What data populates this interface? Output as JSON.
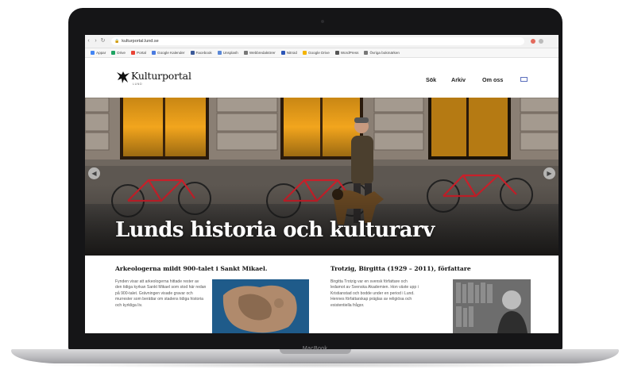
{
  "device": {
    "brand_label": "MacBook"
  },
  "browser": {
    "url": "kulturportal.lund.se",
    "bookmarks": [
      {
        "label": "Appar",
        "icon": "apps-icon",
        "color": "#4285f4"
      },
      {
        "label": "Drive",
        "icon": "drive-icon",
        "color": "#1fa463"
      },
      {
        "label": "Portal",
        "icon": "bookmark-icon",
        "color": "#e94335"
      },
      {
        "label": "Google Kalender",
        "icon": "calendar-icon",
        "color": "#4a7be0"
      },
      {
        "label": "Facebook",
        "icon": "facebook-icon",
        "color": "#3b5998"
      },
      {
        "label": "Unsplash",
        "icon": "bookmark-icon",
        "color": "#5a88d6"
      },
      {
        "label": "Webbredaktörer",
        "icon": "folder-icon",
        "color": "#777777"
      },
      {
        "label": "Nitroid",
        "icon": "bookmark-icon",
        "color": "#2c56b8"
      },
      {
        "label": "Google Drive",
        "icon": "drive-icon",
        "color": "#f4b400"
      },
      {
        "label": "WordPress",
        "icon": "bookmark-icon",
        "color": "#555555"
      },
      {
        "label": "Övriga bokmärken",
        "icon": "folder-icon",
        "color": "#777777"
      }
    ]
  },
  "site": {
    "logo_name": "Kulturportal",
    "logo_sub": "LUND",
    "nav": [
      "Sök",
      "Arkiv",
      "Om oss"
    ],
    "lang_icon": "flag-icon"
  },
  "hero": {
    "title": "Lunds historia och kulturarv",
    "prev_icon": "chevron-left-icon",
    "next_icon": "chevron-right-icon",
    "colors": {
      "bicycle": "#c8202a",
      "window_light": "#f2a51d",
      "stone": "#8a7f74"
    }
  },
  "articles": [
    {
      "title": "Arkeologerna mildt 900-talet i Sankt Mikael.",
      "excerpt": "Fynden visar att arkeologerna hittade rester av den tidiga kyrkan Sankt Mikael som stod här redan på 900-talet. Grävningen visade gravar och murrester som berättar om stadens tidiga historia och kyrkliga liv."
    },
    {
      "title": "Trotzig, Birgitta (1929 – 2011), författare",
      "excerpt": "Birgitta Trotzig var en svensk författare och ledamot av Svenska Akademien. Hon växte upp i Kristianstad och bodde under en period i Lund. Hennes författarskap präglas av religiösa och existentiella frågor."
    }
  ]
}
